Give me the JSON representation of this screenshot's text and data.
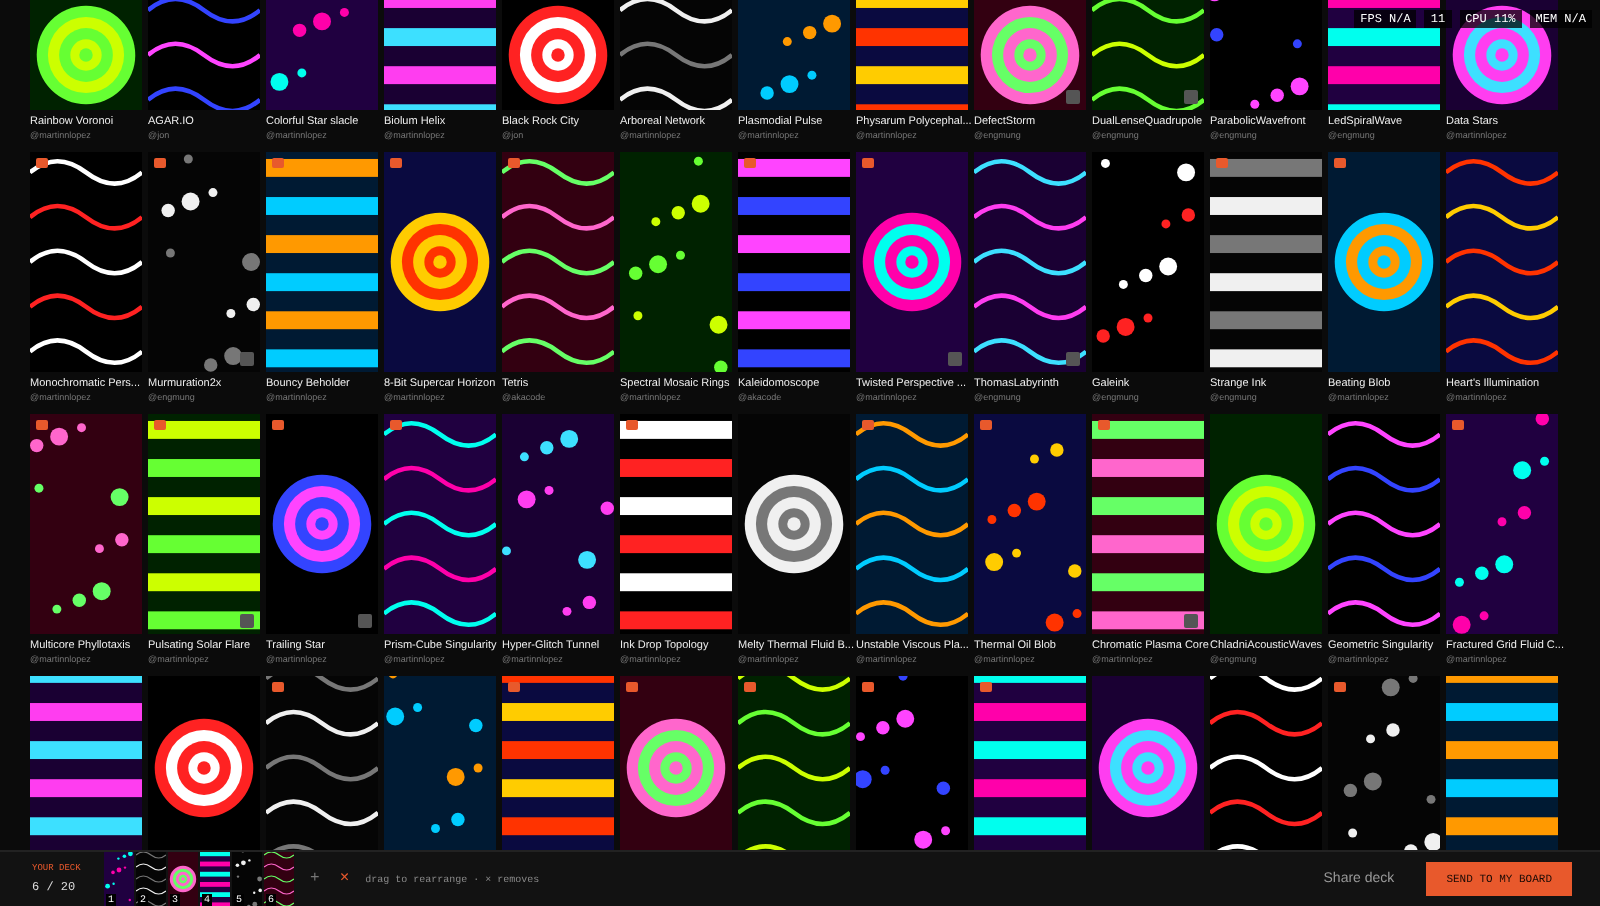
{
  "stats": [
    "FPS N/A",
    "11",
    "CPU 11%",
    "MEM N/A"
  ],
  "rows": [
    [
      {
        "title": "Rainbow Voronoi",
        "author": "@martinnlopez",
        "flagged": false,
        "corner_button": false
      },
      {
        "title": "AGAR.IO",
        "author": "@jon",
        "flagged": false,
        "corner_button": false
      },
      {
        "title": "Colorful Star slacle",
        "author": "@martinnlopez",
        "flagged": false,
        "corner_button": false
      },
      {
        "title": "Biolum Helix",
        "author": "@martinnlopez",
        "flagged": false,
        "corner_button": false
      },
      {
        "title": "Black Rock City",
        "author": "@jon",
        "flagged": false,
        "corner_button": false
      },
      {
        "title": "Arboreal Network",
        "author": "@martinnlopez",
        "flagged": false,
        "corner_button": false
      },
      {
        "title": "Plasmodial Pulse",
        "author": "@martinnlopez",
        "flagged": false,
        "corner_button": false
      },
      {
        "title": "Physarum Polycephal...",
        "author": "@martinnlopez",
        "flagged": false,
        "corner_button": false
      },
      {
        "title": "DefectStorm",
        "author": "@engmung",
        "flagged": false,
        "corner_button": true
      },
      {
        "title": "DualLenseQuadrupole",
        "author": "@engmung",
        "flagged": false,
        "corner_button": true
      },
      {
        "title": "ParabolicWavefront",
        "author": "@engmung",
        "flagged": false,
        "corner_button": false
      },
      {
        "title": "LedSpiralWave",
        "author": "@engmung",
        "flagged": false,
        "corner_button": false
      },
      {
        "title": "Data Stars",
        "author": "@martinnlopez",
        "flagged": false,
        "corner_button": false
      }
    ],
    [
      {
        "title": "Monochromatic Pers...",
        "author": "@martinnlopez",
        "flagged": true,
        "corner_button": false
      },
      {
        "title": "Murmuration2x",
        "author": "@engmung",
        "flagged": true,
        "corner_button": true
      },
      {
        "title": "Bouncy Beholder",
        "author": "@martinnlopez",
        "flagged": true,
        "corner_button": false
      },
      {
        "title": "8-Bit Supercar Horizon",
        "author": "@martinnlopez",
        "flagged": true,
        "corner_button": false
      },
      {
        "title": "Tetris",
        "author": "@akacode",
        "flagged": true,
        "corner_button": false
      },
      {
        "title": "Spectral Mosaic Rings",
        "author": "@martinnlopez",
        "flagged": false,
        "corner_button": false
      },
      {
        "title": "Kaleidomoscope",
        "author": "@akacode",
        "flagged": true,
        "corner_button": false
      },
      {
        "title": "Twisted Perspective ...",
        "author": "@martinnlopez",
        "flagged": true,
        "corner_button": true
      },
      {
        "title": "ThomasLabyrinth",
        "author": "@engmung",
        "flagged": false,
        "corner_button": true
      },
      {
        "title": "Galeink",
        "author": "@engmung",
        "flagged": false,
        "corner_button": false
      },
      {
        "title": "Strange Ink",
        "author": "@engmung",
        "flagged": true,
        "corner_button": false
      },
      {
        "title": "Beating Blob",
        "author": "@martinnlopez",
        "flagged": true,
        "corner_button": false
      },
      {
        "title": "Heart's Illumination",
        "author": "@martinnlopez",
        "flagged": false,
        "corner_button": false
      }
    ],
    [
      {
        "title": "Multicore Phyllotaxis",
        "author": "@martinnlopez",
        "flagged": true,
        "corner_button": false
      },
      {
        "title": "Pulsating Solar Flare",
        "author": "@martinnlopez",
        "flagged": true,
        "corner_button": true
      },
      {
        "title": "Trailing Star",
        "author": "@martinnlopez",
        "flagged": true,
        "corner_button": true
      },
      {
        "title": "Prism-Cube Singularity",
        "author": "@martinnlopez",
        "flagged": true,
        "corner_button": false
      },
      {
        "title": "Hyper-Glitch Tunnel",
        "author": "@martinnlopez",
        "flagged": false,
        "corner_button": false
      },
      {
        "title": "Ink Drop Topology",
        "author": "@martinnlopez",
        "flagged": true,
        "corner_button": false
      },
      {
        "title": "Melty Thermal Fluid B...",
        "author": "@martinnlopez",
        "flagged": false,
        "corner_button": false
      },
      {
        "title": "Unstable Viscous Pla...",
        "author": "@martinnlopez",
        "flagged": true,
        "corner_button": false
      },
      {
        "title": "Thermal Oil Blob",
        "author": "@martinnlopez",
        "flagged": true,
        "corner_button": false
      },
      {
        "title": "Chromatic Plasma Core",
        "author": "@martinnlopez",
        "flagged": true,
        "corner_button": true
      },
      {
        "title": "ChladniAcousticWaves",
        "author": "@engmung",
        "flagged": false,
        "corner_button": false
      },
      {
        "title": "Geometric Singularity",
        "author": "@martinnlopez",
        "flagged": false,
        "corner_button": false
      },
      {
        "title": "Fractured Grid Fluid C...",
        "author": "@martinnlopez",
        "flagged": true,
        "corner_button": false
      }
    ],
    [
      {
        "flagged": false,
        "corner_button": false
      },
      {
        "flagged": false,
        "corner_button": false
      },
      {
        "flagged": true,
        "corner_button": false
      },
      {
        "flagged": false,
        "corner_button": false
      },
      {
        "flagged": true,
        "corner_button": false
      },
      {
        "flagged": true,
        "corner_button": false
      },
      {
        "flagged": true,
        "corner_button": false
      },
      {
        "flagged": true,
        "corner_button": false
      },
      {
        "flagged": true,
        "corner_button": false
      },
      {
        "flagged": false,
        "corner_button": false
      },
      {
        "flagged": false,
        "corner_button": false
      },
      {
        "flagged": true,
        "corner_button": false
      },
      {
        "flagged": false,
        "corner_button": false
      }
    ]
  ],
  "deck": {
    "title": "YOUR DECK",
    "count": "6 / 20",
    "items": [
      {
        "number": "1"
      },
      {
        "number": "2"
      },
      {
        "number": "3"
      },
      {
        "number": "4"
      },
      {
        "number": "5"
      },
      {
        "number": "6"
      }
    ],
    "add": "+",
    "clear": "×",
    "hint": "drag to rearrange · × removes",
    "share": "Share deck",
    "send": "SEND TO MY BOARD"
  }
}
